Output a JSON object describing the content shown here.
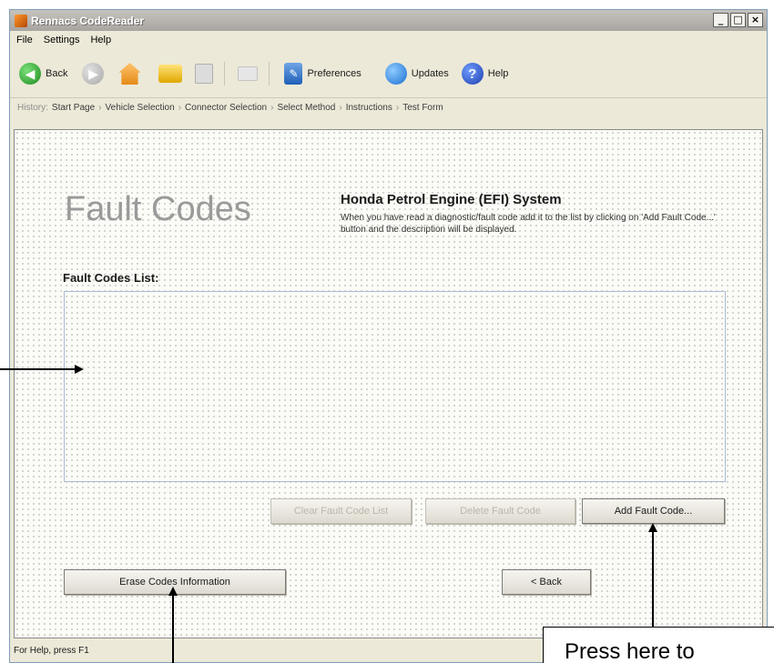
{
  "window": {
    "title": "Rennacs CodeReader",
    "controls": [
      "_",
      "□",
      "×"
    ]
  },
  "menu": {
    "items": [
      "File",
      "Settings",
      "Help"
    ]
  },
  "toolbar": {
    "back_label": "Back",
    "preferences_label": "Preferences",
    "updates_label": "Updates",
    "help_label": "Help"
  },
  "history": {
    "label": "History:",
    "items": [
      "Start Page",
      "Vehicle Selection",
      "Connector Selection",
      "Select Method",
      "Instructions",
      "Test Form"
    ],
    "separator": "›"
  },
  "main": {
    "title": "Fault Codes",
    "system_title": "Honda Petrol Engine (EFI) System",
    "system_description": "When you have read a diagnostic/fault code add it to the list by clicking on 'Add Fault Code...' button and the description will be displayed.",
    "list_label": "Fault Codes List:",
    "buttons": {
      "clear": "Clear Fault Code List",
      "delete": "Delete Fault Code",
      "add": "Add Fault Code...",
      "erase": "Erase Codes Information",
      "back": "< Back"
    }
  },
  "statusbar": {
    "text": "For Help, press F1"
  },
  "annotation": {
    "callout_text": "Press here to"
  },
  "icons": {
    "back": "back-arrow-icon",
    "forward": "forward-arrow-icon",
    "home": "home-icon",
    "open": "open-folder-icon",
    "save": "save-disk-icon",
    "print": "print-icon",
    "preferences": "preferences-icon",
    "updates": "globe-icon",
    "help": "help-icon"
  }
}
